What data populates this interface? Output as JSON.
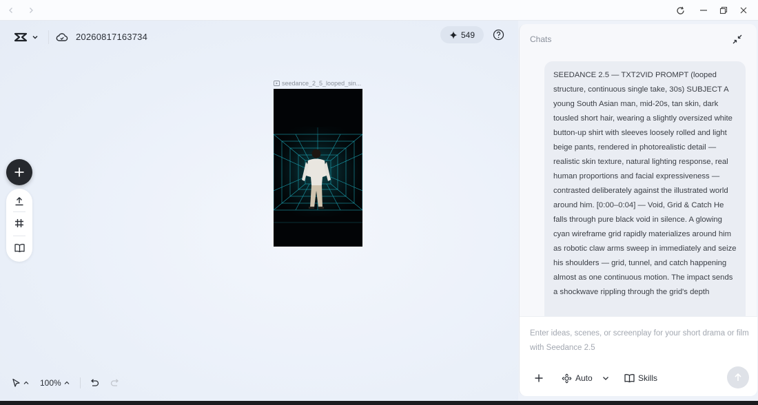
{
  "project": {
    "name": "20260817163734"
  },
  "credits": {
    "value": "549"
  },
  "video": {
    "filename": "seedance_2_5_looped_sin..."
  },
  "zoom": {
    "level": "100%"
  },
  "chat": {
    "title": "Chats",
    "message": "SEEDANCE 2.5 — TXT2VID PROMPT (looped structure, continuous single take, 30s) SUBJECT A young South Asian man, mid-20s, tan skin, dark tousled short hair, wearing a slightly oversized white button-up shirt with sleeves loosely rolled and light beige pants, rendered in photorealistic detail — realistic skin texture, natural lighting response, real human proportions and facial expressiveness — contrasted deliberately against the illustrated world around him. [0:00–0:04] — Void, Grid & Catch He falls through pure black void in silence. A glowing cyan wireframe grid rapidly materializes around him as robotic claw arms sweep in immediately and seize his shoulders — grid, tunnel, and catch happening almost as one continuous motion. The impact sends a shockwave rippling through the grid's depth",
    "placeholder": "Enter ideas, scenes, or screenplay for your short drama or film with Seedance 2.5",
    "mode_label": "Auto",
    "skills_label": "Skills"
  },
  "colors": {
    "accent_cyan": "#1fb8c9",
    "fab": "#26292e",
    "bg": "#eef2f9"
  }
}
